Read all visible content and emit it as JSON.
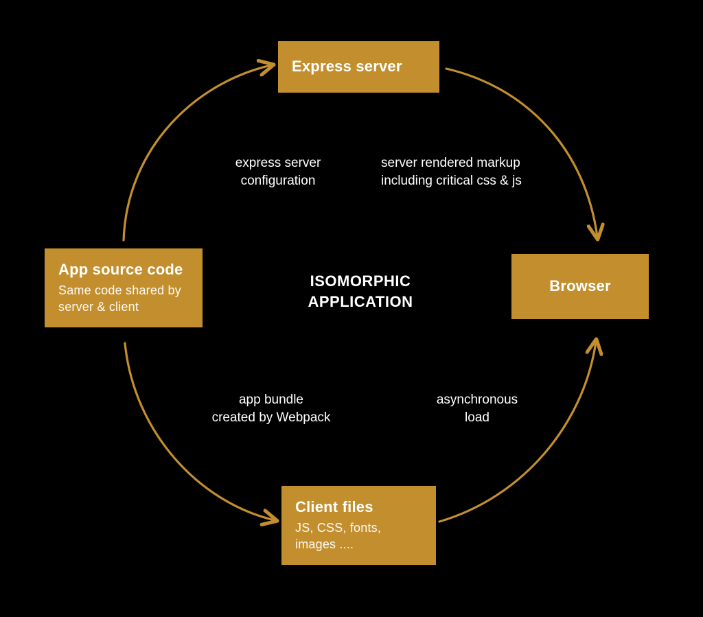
{
  "center": {
    "line1": "ISOMORPHIC",
    "line2": "APPLICATION"
  },
  "nodes": {
    "express": {
      "title": "Express server"
    },
    "browser": {
      "title": "Browser"
    },
    "client": {
      "title": "Client files",
      "sub": "JS, CSS, fonts,\nimages ...."
    },
    "source": {
      "title": "App source code",
      "sub": "Same code shared\nby server & client"
    }
  },
  "edges": {
    "top_left": "express server\nconfiguration",
    "top_right": "server rendered markup\nincluding critical css & js",
    "bot_right": "asynchronous\nload",
    "bot_left": "app bundle\ncreated by Webpack"
  },
  "colors": {
    "accent": "#c38f2e"
  }
}
